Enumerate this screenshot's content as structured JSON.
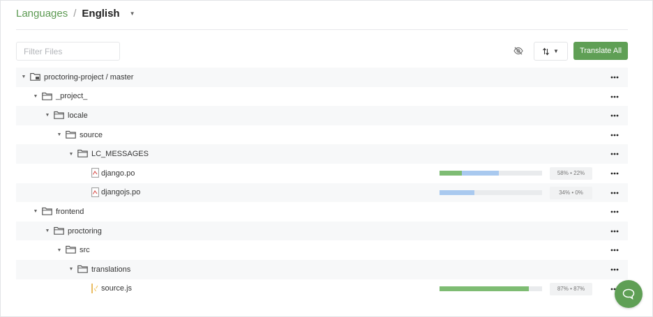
{
  "breadcrumb": {
    "root": "Languages",
    "separator": "/",
    "current": "English"
  },
  "toolbar": {
    "filter_placeholder": "Filter Files",
    "hide_icon": "eye-slash-icon",
    "sort_icon": "sort-arrows-icon",
    "translate_all_label": "Translate All"
  },
  "tree": [
    {
      "type": "project",
      "depth": 0,
      "name": "proctoring-project / master",
      "expanded": true
    },
    {
      "type": "folder",
      "depth": 1,
      "name": "_project_",
      "expanded": true
    },
    {
      "type": "folder",
      "depth": 2,
      "name": "locale",
      "expanded": true
    },
    {
      "type": "folder",
      "depth": 3,
      "name": "source",
      "expanded": true
    },
    {
      "type": "folder",
      "depth": 4,
      "name": "LC_MESSAGES",
      "expanded": true
    },
    {
      "type": "file",
      "depth": 5,
      "name": "django.po",
      "file_icon": "po-file-icon",
      "translated": 22,
      "suggested": 58,
      "stats": "58% • 22%"
    },
    {
      "type": "file",
      "depth": 5,
      "name": "djangojs.po",
      "file_icon": "po-file-icon",
      "translated": 0,
      "suggested": 34,
      "stats": "34% • 0%"
    },
    {
      "type": "folder",
      "depth": 1,
      "name": "frontend",
      "expanded": true
    },
    {
      "type": "folder",
      "depth": 2,
      "name": "proctoring",
      "expanded": true
    },
    {
      "type": "folder",
      "depth": 3,
      "name": "src",
      "expanded": true
    },
    {
      "type": "folder",
      "depth": 4,
      "name": "translations",
      "expanded": true
    },
    {
      "type": "file",
      "depth": 5,
      "name": "source.js",
      "file_icon": "js-file-icon",
      "translated": 87,
      "suggested": 87,
      "stats": "87% • 87%"
    }
  ],
  "colors": {
    "accent": "#5f9f55",
    "translated": "#7ebc73",
    "suggested": "#a9c9ef"
  },
  "help_icon": "chat-bubble-icon"
}
